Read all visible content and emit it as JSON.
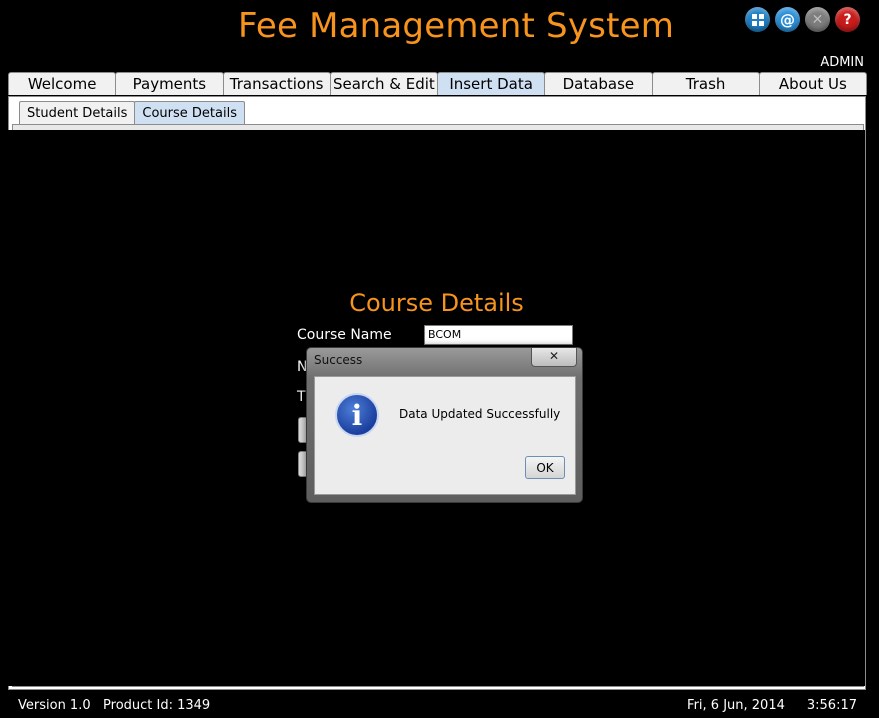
{
  "app": {
    "title": "Fee Management System",
    "user": "ADMIN"
  },
  "top_icons": [
    {
      "name": "apps-grid-icon"
    },
    {
      "name": "at-email-icon",
      "glyph": "@"
    },
    {
      "name": "close-circle-icon",
      "glyph": "✕"
    },
    {
      "name": "help-icon",
      "glyph": "?"
    }
  ],
  "tabs": [
    {
      "label": "Welcome"
    },
    {
      "label": "Payments"
    },
    {
      "label": "Transactions"
    },
    {
      "label": "Search & Edit"
    },
    {
      "label": "Insert Data",
      "active": true
    },
    {
      "label": "Database"
    },
    {
      "label": "Trash"
    },
    {
      "label": "About Us"
    }
  ],
  "subtabs": [
    {
      "label": "Student Details"
    },
    {
      "label": "Course Details",
      "active": true
    }
  ],
  "form": {
    "title": "Course Details",
    "course_name_label": "Course Name",
    "course_name_value": "BCOM",
    "label2_partial": "N",
    "label3_partial": "T"
  },
  "dialog": {
    "title": "Success",
    "message": "Data Updated Successfully",
    "ok_label": "OK",
    "close_glyph": "✕",
    "info_glyph": "i"
  },
  "status": {
    "version": "Version 1.0",
    "product_id": "Product Id: 1349",
    "date": "Fri, 6 Jun, 2014",
    "time": "3:56:17"
  },
  "colors": {
    "accent": "#f7941d",
    "background": "#000000",
    "active_tab": "#cfe0f3"
  }
}
